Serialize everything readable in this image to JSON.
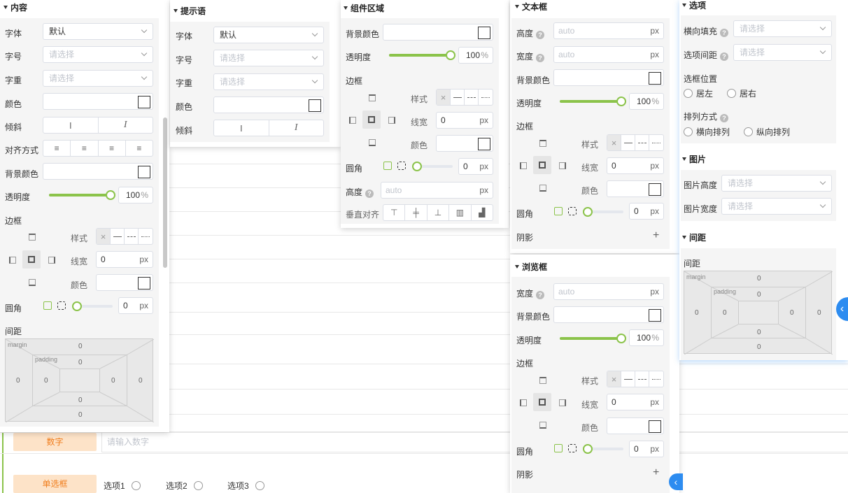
{
  "background": {
    "number_label": "数字",
    "number_placeholder": "请输入数字",
    "radio_label": "单选框",
    "radio_options": [
      "选项1",
      "选项2",
      "选项3"
    ]
  },
  "content": {
    "title": "内容",
    "font_label": "字体",
    "font_value": "默认",
    "size_label": "字号",
    "size_placeholder": "请选择",
    "weight_label": "字重",
    "weight_placeholder": "请选择",
    "color_label": "颜色",
    "italic_label": "倾斜",
    "align_label": "对齐方式",
    "bg_label": "背景颜色",
    "opacity_label": "透明度",
    "opacity_value": "100",
    "border_label": "边框",
    "style_label": "样式",
    "width_label": "线宽",
    "width_value": "0",
    "bcolor_label": "颜色",
    "radius_label": "圆角",
    "radius_value": "0",
    "spacing_label": "间距",
    "opacity_percent": 0.92
  },
  "hint": {
    "title": "提示语",
    "font_label": "字体",
    "font_value": "默认",
    "size_label": "字号",
    "size_placeholder": "请选择",
    "weight_label": "字重",
    "weight_placeholder": "请选择",
    "color_label": "颜色",
    "italic_label": "倾斜"
  },
  "area": {
    "title": "组件区域",
    "bg_label": "背景颜色",
    "opacity_label": "透明度",
    "opacity_value": "100",
    "border_label": "边框",
    "style_label": "样式",
    "width_label": "线宽",
    "width_value": "0",
    "bcolor_label": "颜色",
    "radius_label": "圆角",
    "radius_value": "0",
    "height_label": "高度",
    "height_placeholder": "auto",
    "valign_label": "垂直对齐"
  },
  "textbox": {
    "title": "文本框",
    "height_label": "高度",
    "height_placeholder": "auto",
    "width_label": "宽度",
    "width_placeholder": "auto",
    "bg_label": "背景颜色",
    "opacity_label": "透明度",
    "opacity_value": "100",
    "border_label": "边框",
    "style_label": "样式",
    "width2_label": "线宽",
    "width2_value": "0",
    "bcolor_label": "颜色",
    "radius_label": "圆角",
    "radius_value": "0",
    "shadow_label": "阴影"
  },
  "browse": {
    "title": "浏览框",
    "width_label": "宽度",
    "width_placeholder": "auto",
    "bg_label": "背景颜色",
    "opacity_label": "透明度",
    "opacity_value": "100",
    "border_label": "边框",
    "style_label": "样式",
    "width2_label": "线宽",
    "width2_value": "0",
    "bcolor_label": "颜色",
    "radius_label": "圆角",
    "radius_value": "0",
    "shadow_label": "阴影"
  },
  "options": {
    "title": "选项",
    "hfill_label": "横向填充",
    "hfill_placeholder": "请选择",
    "gap_label": "选项间距",
    "gap_placeholder": "请选择",
    "pos_label": "选框位置",
    "pos_left": "居左",
    "pos_right": "居右",
    "arrange_label": "排列方式",
    "arrange_h": "横向排列",
    "arrange_v": "纵向排列"
  },
  "image": {
    "title": "图片",
    "height_label": "图片高度",
    "height_placeholder": "请选择",
    "width_label": "图片宽度",
    "width_placeholder": "请选择"
  },
  "spacing": {
    "title": "间距",
    "label": "间距"
  },
  "boxmodel": {
    "margin_label": "margin",
    "padding_label": "padding",
    "zero": "0"
  },
  "units": {
    "px": "px",
    "percent": "%"
  }
}
